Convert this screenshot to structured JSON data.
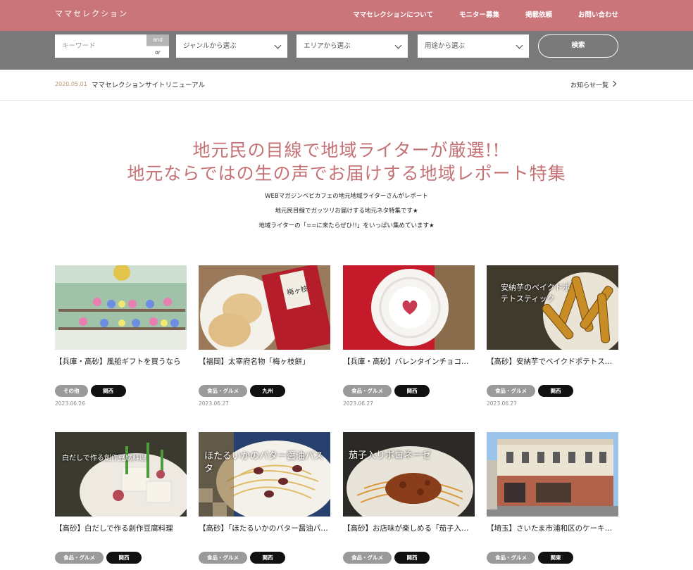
{
  "header": {
    "logo": "ママセレクション",
    "nav": [
      "ママセレクションについて",
      "モニター募集",
      "掲載依頼",
      "お問い合わせ"
    ]
  },
  "search": {
    "keyword_placeholder": "キーワード",
    "and_label": "and",
    "or_label": "or",
    "genre_label": "ジャンルから選ぶ",
    "area_label": "エリアから選ぶ",
    "purpose_label": "用途から選ぶ",
    "button_label": "検索"
  },
  "notice": {
    "date": "2020.05.01",
    "text": "ママセレクションサイトリニューアル",
    "more": "お知らせ一覧"
  },
  "hero": {
    "line1": "地元民の目線で地域ライターが厳選!!",
    "line2": "地元ならではの生の声でお届けする地域レポート特集",
    "sub1": "WEBマガジンベビカフェの地元地域ライターさんがレポート",
    "sub2": "地元民目線でガッツリお届けする地元ネタ特集です★",
    "sub3": "地域ライターの「==に来たらぜひ!!」をいっぱい集めています★"
  },
  "colors": {
    "header": "#c9757a",
    "searchbar": "#7a7a7a",
    "accent": "#c47275"
  },
  "cards": [
    {
      "title": "【兵庫・高砂】風船ギフトを買うなら",
      "genre": "その他",
      "area": "関西",
      "date": "2023.06.26",
      "overlay": ""
    },
    {
      "title": "【福岡】太宰府名物「梅ヶ枝餅」",
      "genre": "食品・グルメ",
      "area": "九州",
      "date": "2023.06.27",
      "overlay": ""
    },
    {
      "title": "【兵庫・高砂】バレンタインチョコレート",
      "genre": "食品・グルメ",
      "area": "関西",
      "date": "2023.06.27",
      "overlay": ""
    },
    {
      "title": "【高砂】安納芋でベイクドポテトスティック",
      "genre": "食品・グルメ",
      "area": "関西",
      "date": "2023.06.27",
      "overlay": "安納芋のベイクドポテトスティック"
    },
    {
      "title": "【高砂】白だしで作る創作豆腐料理",
      "genre": "食品・グルメ",
      "area": "関西",
      "date": "",
      "overlay": "白だしで作る創作豆腐料理"
    },
    {
      "title": "【高砂】「ほたるいかのバター醤油パスタ」",
      "genre": "食品・グルメ",
      "area": "関西",
      "date": "",
      "overlay": "ほたるいかのバター醤油パスタ"
    },
    {
      "title": "【高砂】お店味が楽しめる「茄子入りボロネーゼ」",
      "genre": "食品・グルメ",
      "area": "関西",
      "date": "",
      "overlay": "茄子入りボロネーゼ"
    },
    {
      "title": "【埼玉】さいたま市浦和区のケーキ屋さん",
      "genre": "食品・グルメ",
      "area": "関東",
      "date": "",
      "overlay": ""
    }
  ]
}
